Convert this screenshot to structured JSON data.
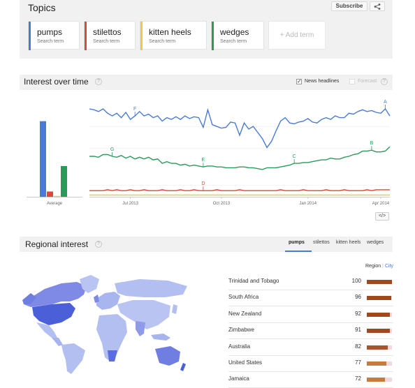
{
  "topics": {
    "title": "Topics",
    "subscribe_label": "Subscribe",
    "share_icon": "share-icon",
    "terms": [
      {
        "name": "pumps",
        "sub": "Search term",
        "color": "#4a7bd4"
      },
      {
        "name": "stilettos",
        "sub": "Search term",
        "color": "#d9483b"
      },
      {
        "name": "kitten heels",
        "sub": "Search term",
        "color": "#f5c73f"
      },
      {
        "name": "wedges",
        "sub": "Search term",
        "color": "#2a9a5a"
      }
    ],
    "add_term_label": "+ Add term"
  },
  "interest_over_time": {
    "title": "Interest over time",
    "help": "?",
    "news_headlines_label": "News headlines",
    "news_checked": true,
    "forecast_label": "Forecast",
    "forecast_checked": false,
    "embed_label": "</>"
  },
  "chart_data": {
    "type": "line",
    "x_ticks": [
      "Jul 2013",
      "Oct 2013",
      "Jan 2014",
      "Apr 2014"
    ],
    "average_label": "Average",
    "averages": [
      {
        "term": "pumps",
        "value": 86
      },
      {
        "term": "stilettos",
        "value": 6
      },
      {
        "term": "kitten heels",
        "value": 1
      },
      {
        "term": "wedges",
        "value": 35
      }
    ],
    "series": [
      {
        "name": "pumps",
        "color": "#4a7bd4",
        "values": [
          100,
          99,
          97,
          100,
          95,
          92,
          95,
          90,
          96,
          88,
          92,
          97,
          92,
          94,
          90,
          92,
          86,
          90,
          88,
          91,
          88,
          92,
          89,
          91,
          90,
          79,
          99,
          82,
          80,
          78,
          79,
          85,
          84,
          70,
          84,
          77,
          80,
          73,
          66,
          56,
          63,
          75,
          86,
          90,
          84,
          83,
          85,
          86,
          89,
          85,
          84,
          88,
          90,
          88,
          92,
          90,
          90,
          95,
          94,
          97,
          99,
          97,
          98,
          96,
          95,
          100,
          92
        ]
      },
      {
        "name": "stilettos",
        "color": "#d9483b",
        "values": [
          7,
          7,
          7,
          7,
          8,
          7,
          8,
          7,
          7,
          8,
          7,
          7,
          8,
          7,
          7,
          7,
          8,
          7,
          7,
          7,
          8,
          7,
          7,
          8,
          7,
          7,
          7,
          7,
          8,
          7,
          7,
          7,
          7,
          8,
          7,
          7,
          7,
          7,
          7,
          7,
          7,
          7,
          8,
          7,
          7,
          7,
          7,
          8,
          7,
          7,
          7,
          7,
          8,
          7,
          7,
          7,
          8,
          7,
          7,
          7,
          7,
          8,
          7,
          8,
          8,
          8,
          8
        ]
      },
      {
        "name": "kitten heels",
        "color": "#f5c73f",
        "values": [
          2,
          2,
          2,
          2,
          2,
          2,
          2,
          2,
          2,
          2,
          2,
          2,
          2,
          2,
          2,
          2,
          2,
          2,
          2,
          2,
          2,
          2,
          2,
          2,
          2,
          2,
          2,
          2,
          2,
          2,
          2,
          2,
          2,
          2,
          2,
          2,
          2,
          2,
          2,
          2,
          2,
          2,
          2,
          2,
          2,
          2,
          2,
          2,
          2,
          2,
          2,
          2,
          2,
          2,
          2,
          2,
          2,
          2,
          2,
          2,
          2,
          2,
          2,
          2,
          2,
          2,
          2
        ]
      },
      {
        "name": "wedges",
        "color": "#2a9a5a",
        "values": [
          46,
          46,
          45,
          48,
          48,
          46,
          45,
          47,
          44,
          46,
          43,
          45,
          43,
          45,
          42,
          43,
          38,
          40,
          38,
          38,
          36,
          37,
          35,
          36,
          35,
          34,
          35,
          35,
          34,
          34,
          33,
          33,
          33,
          34,
          34,
          33,
          33,
          32,
          31,
          33,
          33,
          33,
          34,
          35,
          36,
          38,
          38,
          39,
          39,
          40,
          41,
          42,
          42,
          44,
          43,
          43,
          45,
          46,
          48,
          49,
          52,
          52,
          53,
          51,
          51,
          52,
          57
        ]
      }
    ],
    "news_markers": [
      {
        "letter": "F",
        "index": 10,
        "series": "pumps"
      },
      {
        "letter": "A",
        "index": 65,
        "series": "pumps"
      },
      {
        "letter": "G",
        "index": 5,
        "series": "wedges"
      },
      {
        "letter": "E",
        "index": 25,
        "series": "wedges"
      },
      {
        "letter": "C",
        "index": 45,
        "series": "wedges"
      },
      {
        "letter": "B",
        "index": 62,
        "series": "wedges"
      },
      {
        "letter": "D",
        "index": 25,
        "series": "stilettos"
      }
    ]
  },
  "regional_interest": {
    "title": "Regional interest",
    "help": "?",
    "tabs": [
      "pumps",
      "stilettos",
      "kitten heels",
      "wedges"
    ],
    "active_tab": "pumps",
    "region_label": "Region",
    "city_label": "City",
    "rows": [
      {
        "name": "Trinidad and Tobago",
        "value": 100
      },
      {
        "name": "South Africa",
        "value": 96
      },
      {
        "name": "New Zealand",
        "value": 92
      },
      {
        "name": "Zimbabwe",
        "value": 91
      },
      {
        "name": "Australia",
        "value": 82
      },
      {
        "name": "United States",
        "value": 77
      },
      {
        "name": "Jamaica",
        "value": 72
      }
    ]
  }
}
